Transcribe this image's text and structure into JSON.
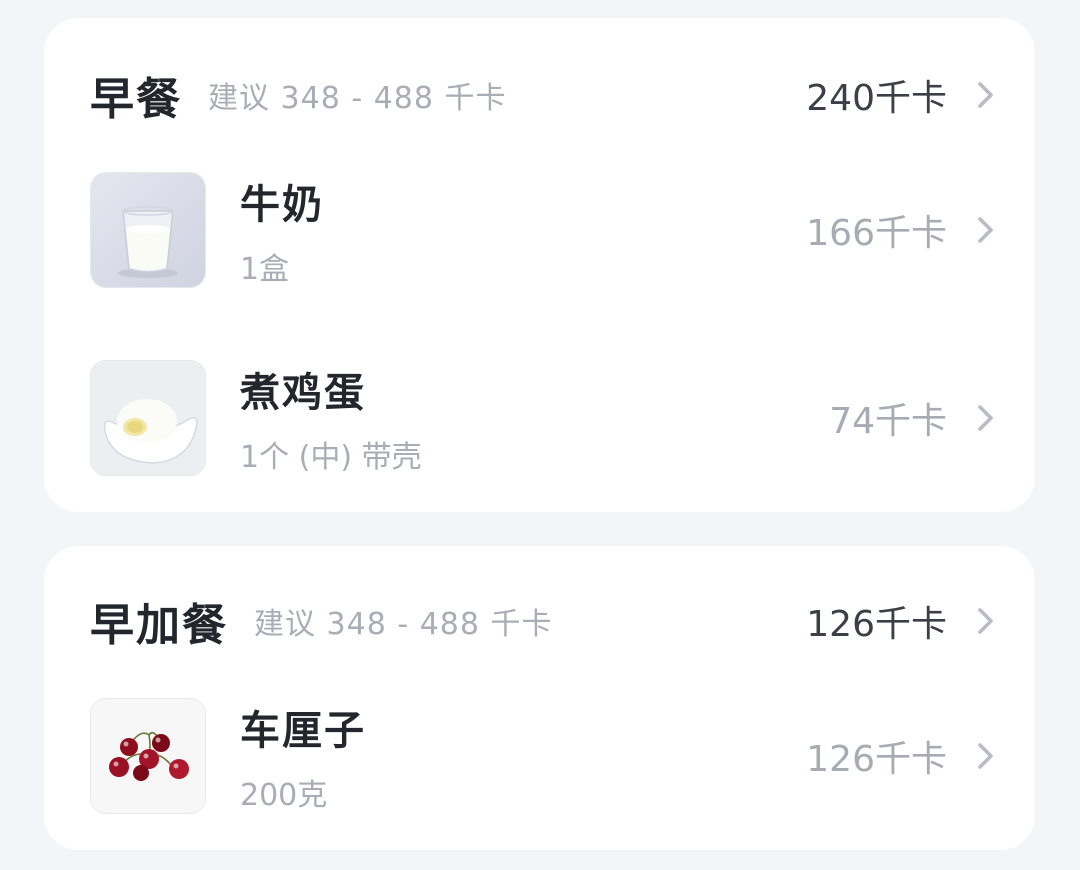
{
  "meals": [
    {
      "title": "早餐",
      "suggestion": "建议 348 - 488 千卡",
      "total": "240千卡",
      "foods": [
        {
          "name": "牛奶",
          "amount": "1盒",
          "kcal": "166千卡",
          "icon": "milk-glass-icon"
        },
        {
          "name": "煮鸡蛋",
          "amount": "1个 (中) 带壳",
          "kcal": "74千卡",
          "icon": "boiled-egg-icon"
        }
      ]
    },
    {
      "title": "早加餐",
      "suggestion": "建议 348 - 488 千卡",
      "total": "126千卡",
      "foods": [
        {
          "name": "车厘子",
          "amount": "200克",
          "kcal": "126千卡",
          "icon": "cherries-icon"
        }
      ]
    }
  ],
  "colors": {
    "background": "#f3f5f9",
    "card": "#ffffff",
    "title": "#22262d",
    "muted": "#a9adb6"
  }
}
